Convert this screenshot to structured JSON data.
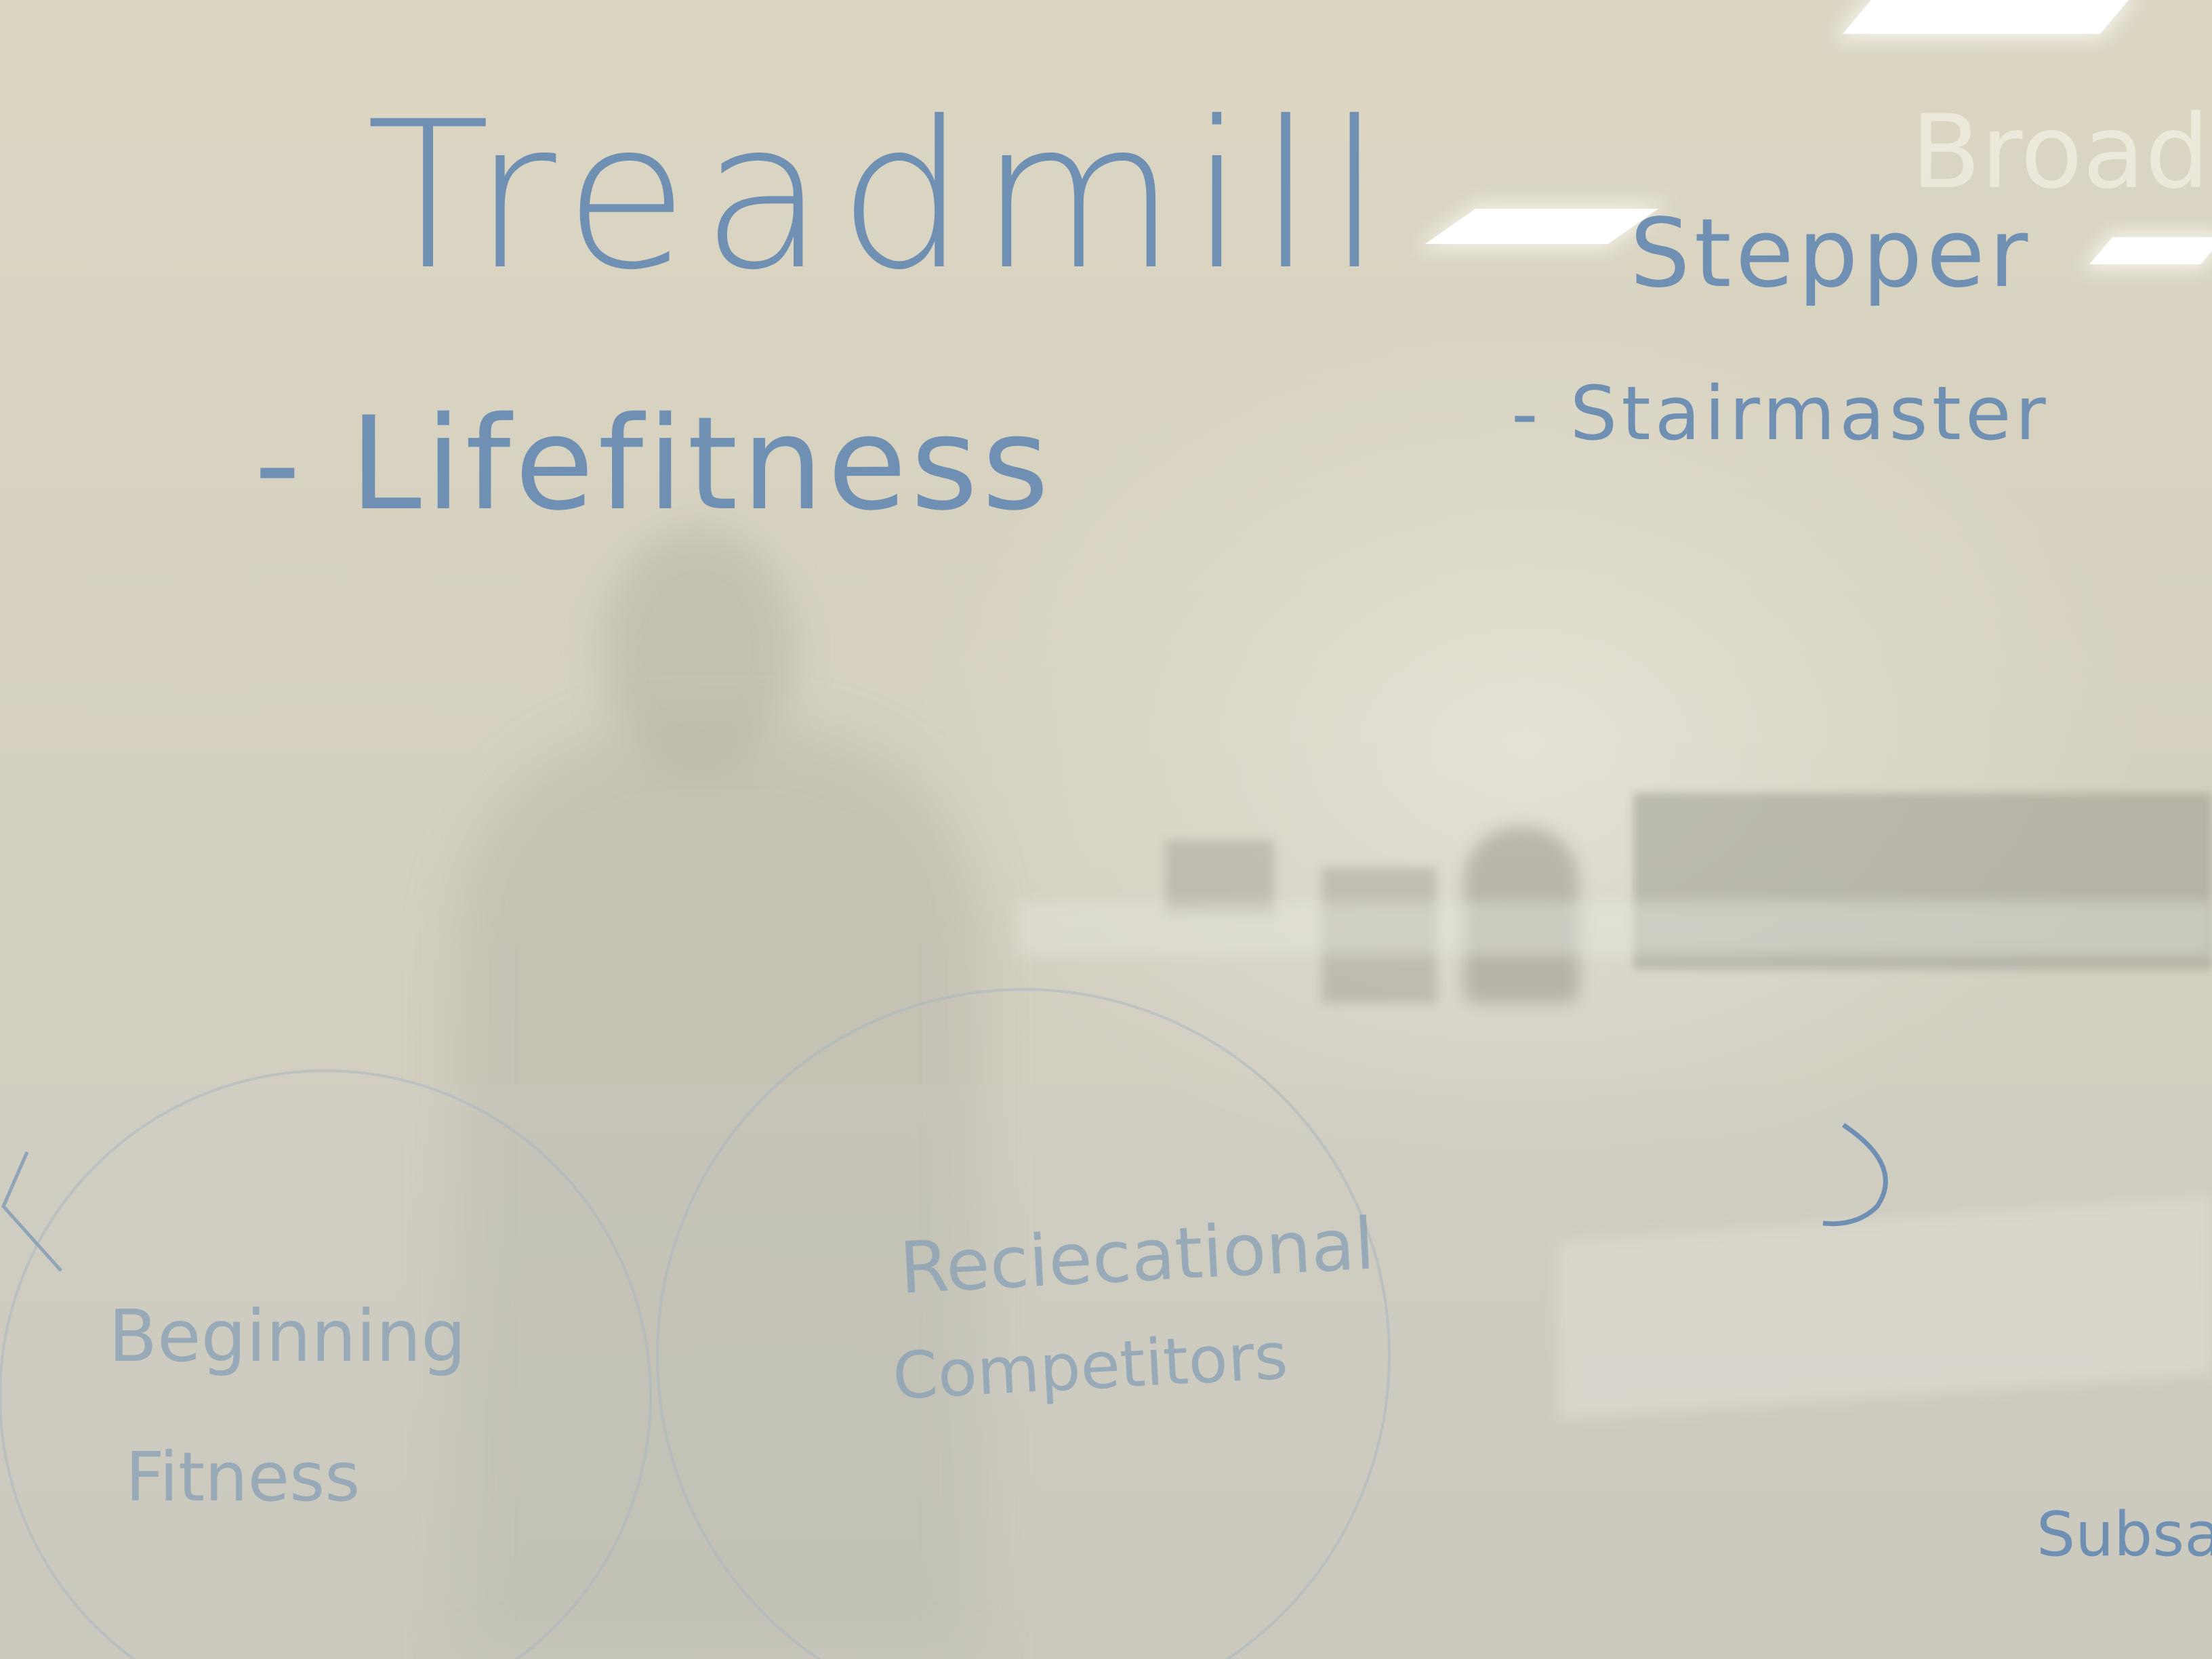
{
  "whiteboard": {
    "heading_left": "Treadmill",
    "item_left": "- Lifefitness",
    "heading_right": "Stepper",
    "item_right": "- Stairmaster",
    "ghost_text": "Broad",
    "segment_beginning_line1": "Beginning",
    "segment_beginning_line2": "Fitness",
    "segment_recreational_line1": "Reciecational",
    "segment_recreational_line2": "Competitors",
    "segment_partial": "Subsan"
  },
  "colors": {
    "marker_ink": "#6f8fb3",
    "board_surface": "#d6d1bf"
  }
}
